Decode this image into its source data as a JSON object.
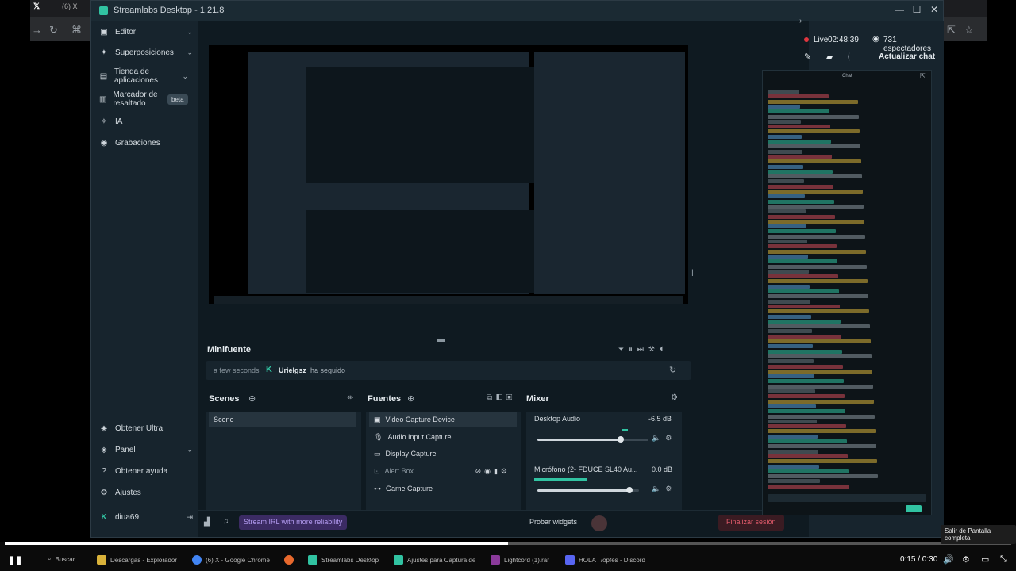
{
  "chrome": {
    "tab_title": "(6) X",
    "window_title": "Streamlabs Desktop - 1.21.8"
  },
  "sidebar": {
    "items": [
      {
        "label": "Editor",
        "icon": "editor-icon"
      },
      {
        "label": "Superposiciones",
        "icon": "overlays-icon"
      },
      {
        "label": "Tienda de aplicaciones",
        "icon": "app-store-icon"
      },
      {
        "label": "Marcador de resaltado",
        "icon": "highlighter-icon"
      },
      {
        "label": "IA",
        "icon": "ai-icon"
      },
      {
        "label": "Grabaciones",
        "icon": "recordings-icon"
      }
    ],
    "beta_badge": "beta",
    "bottom_items": [
      {
        "label": "Obtener Ultra",
        "icon": "ultra-icon"
      },
      {
        "label": "Panel",
        "icon": "dashboard-icon"
      },
      {
        "label": "Obtener ayuda",
        "icon": "help-icon"
      },
      {
        "label": "Ajustes",
        "icon": "gear-icon"
      },
      {
        "label": "diua69",
        "icon": "user-icon"
      }
    ]
  },
  "minifuente": {
    "title": "Minifuente",
    "time": "a few seconds",
    "user": "Urielgsz",
    "action": "ha seguido"
  },
  "scenes": {
    "title": "Scenes",
    "items": [
      "Scene"
    ]
  },
  "sources": {
    "title": "Fuentes",
    "items": [
      {
        "label": "Video Capture Device",
        "icon": "camera-icon"
      },
      {
        "label": "Audio Input Capture",
        "icon": "microphone-icon"
      },
      {
        "label": "Display Capture",
        "icon": "monitor-icon"
      },
      {
        "label": "Alert Box",
        "icon": "alert-icon"
      },
      {
        "label": "Game Capture",
        "icon": "gamepad-icon"
      }
    ]
  },
  "mixer": {
    "title": "Mixer",
    "channels": [
      {
        "name": "Desktop Audio",
        "db": "-6.5 dB",
        "level": 0.75
      },
      {
        "name": "Micrófono (2- FDUCE SL40 Au...",
        "db": "0.0 dB",
        "level": 0.9
      }
    ]
  },
  "bottombar": {
    "promo": "Stream IRL with more reliability",
    "test_widgets": "Probar widgets",
    "end_stream": "Finalizar sesión"
  },
  "live": {
    "label": "Live",
    "time": "02:48:39",
    "viewers": "731 espectadores",
    "refresh_chat": "Actualizar chat"
  },
  "chat": {
    "title": "Chat"
  },
  "video": {
    "time": "0:15 / 0:30",
    "progress": 0.5,
    "tooltip": "Salir de Pantalla completa"
  },
  "taskbar": {
    "search": "Buscar",
    "items": [
      "Descargas - Explorador",
      "(6) X - Google Chrome",
      "Streamlabs Desktop",
      "Ajustes para Captura de",
      "Lightcord (1).rar",
      "HOLA | /opfes - Discord"
    ]
  },
  "colors": {
    "accent": "#31c3a2",
    "live": "#e0363f",
    "panel_bg": "#17242d"
  }
}
